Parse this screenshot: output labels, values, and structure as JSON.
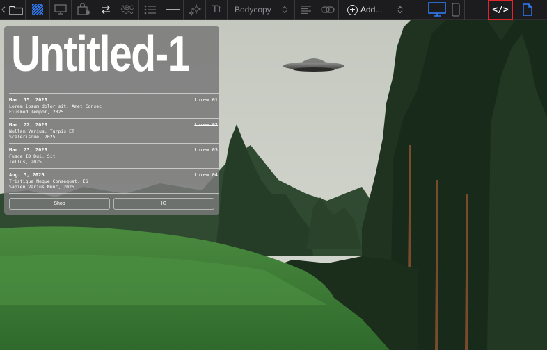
{
  "toolbar": {
    "abc_label": "ABC",
    "tt_label": "Tt",
    "style_select_value": "Bodycopy",
    "add_label": "Add...",
    "code_label": "</>",
    "icons": [
      "back-chevron-icon",
      "folder-icon",
      "layout-icon",
      "monitor-outline-icon",
      "bag-icon",
      "swap-arrows-icon",
      "spellcheck-icon",
      "list-icon",
      "divider-line-icon",
      "sparkle-icon",
      "text-style-icon",
      "align-icon",
      "link-icon",
      "add-icon",
      "desktop-preview-icon",
      "mobile-preview-icon",
      "code-icon",
      "page-icon"
    ],
    "accent_color": "#2f7cf6",
    "highlight_color": "#e0252b"
  },
  "page": {
    "title": "Untitled-1",
    "events": [
      {
        "date": "Mar. 15, 2026",
        "line1": "Lorem ipsum dolor sit, Amet Consec",
        "line2": "Eiusmod Tempor, 2025",
        "tag": "Lorem 01",
        "struck": false
      },
      {
        "date": "Mar. 22, 2026",
        "line1": "Nullam Varius, Turpis ET",
        "line2": "Scelerisque, 2025",
        "tag": "Lorem 02",
        "struck": true
      },
      {
        "date": "Mar. 23, 2026",
        "line1": "Fusce ID Dui, Sit",
        "line2": "Tellus, 2025",
        "tag": "Lorem 03",
        "struck": false
      },
      {
        "date": "Aug. 3, 2026",
        "line1": "Tristique Neque Consequat, ES",
        "line2": "Sapien Varius Nunc, 2025",
        "tag": "Lorem 04",
        "struck": false
      }
    ],
    "buttons": {
      "shop": "Shop",
      "ig": "IG"
    }
  }
}
